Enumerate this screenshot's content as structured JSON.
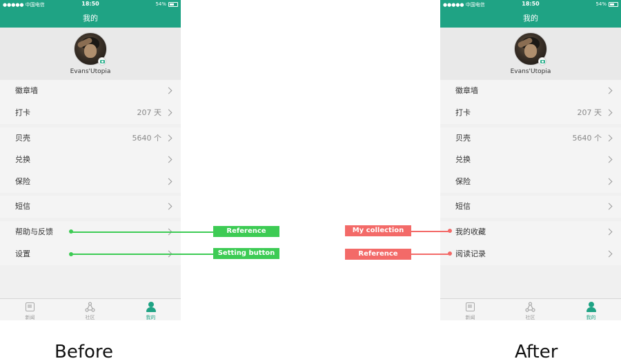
{
  "before_phone": {
    "status": {
      "carrier": "●●●●● 中国电信",
      "time": "18:50",
      "battery_text": "54%",
      "battery_level": 0.54
    },
    "title": "我的",
    "username": "Evans'Utopia",
    "rows": [
      {
        "label": "徽章墙",
        "value": ""
      },
      {
        "label": "打卡",
        "value": "207 天"
      },
      {
        "label": "贝壳",
        "value": "5640 个"
      },
      {
        "label": "兑换",
        "value": ""
      },
      {
        "label": "保险",
        "value": ""
      },
      {
        "label": "短信",
        "value": ""
      },
      {
        "label": "帮助与反馈",
        "value": ""
      },
      {
        "label": "设置",
        "value": ""
      }
    ],
    "tabs": [
      {
        "label": "新闻",
        "icon": "news-icon"
      },
      {
        "label": "社区",
        "icon": "community-icon"
      },
      {
        "label": "我的",
        "icon": "profile-icon",
        "active": true
      }
    ]
  },
  "after_phone": {
    "status": {
      "carrier": "●●●●● 中国电信",
      "time": "18:50",
      "battery_text": "54%",
      "battery_level": 0.54
    },
    "title": "我的",
    "username": "Evans'Utopia",
    "rows": [
      {
        "label": "徽章墙",
        "value": ""
      },
      {
        "label": "打卡",
        "value": "207 天"
      },
      {
        "label": "贝壳",
        "value": "5640 个"
      },
      {
        "label": "兑换",
        "value": ""
      },
      {
        "label": "保险",
        "value": ""
      },
      {
        "label": "短信",
        "value": ""
      },
      {
        "label": "我的收藏",
        "value": ""
      },
      {
        "label": "阅读记录",
        "value": ""
      }
    ],
    "tabs": [
      {
        "label": "新闻",
        "icon": "news-icon"
      },
      {
        "label": "社区",
        "icon": "community-icon"
      },
      {
        "label": "我的",
        "icon": "profile-icon",
        "active": true
      }
    ]
  },
  "annotations": {
    "before": [
      "Reference",
      "Setting button"
    ],
    "after": [
      "My collection",
      "Reference"
    ]
  },
  "captions": {
    "before": "Before",
    "after": "After"
  },
  "colors": {
    "brand": "#1fa384",
    "annotation_green": "#3dcb54",
    "annotation_red": "#f36a68"
  }
}
